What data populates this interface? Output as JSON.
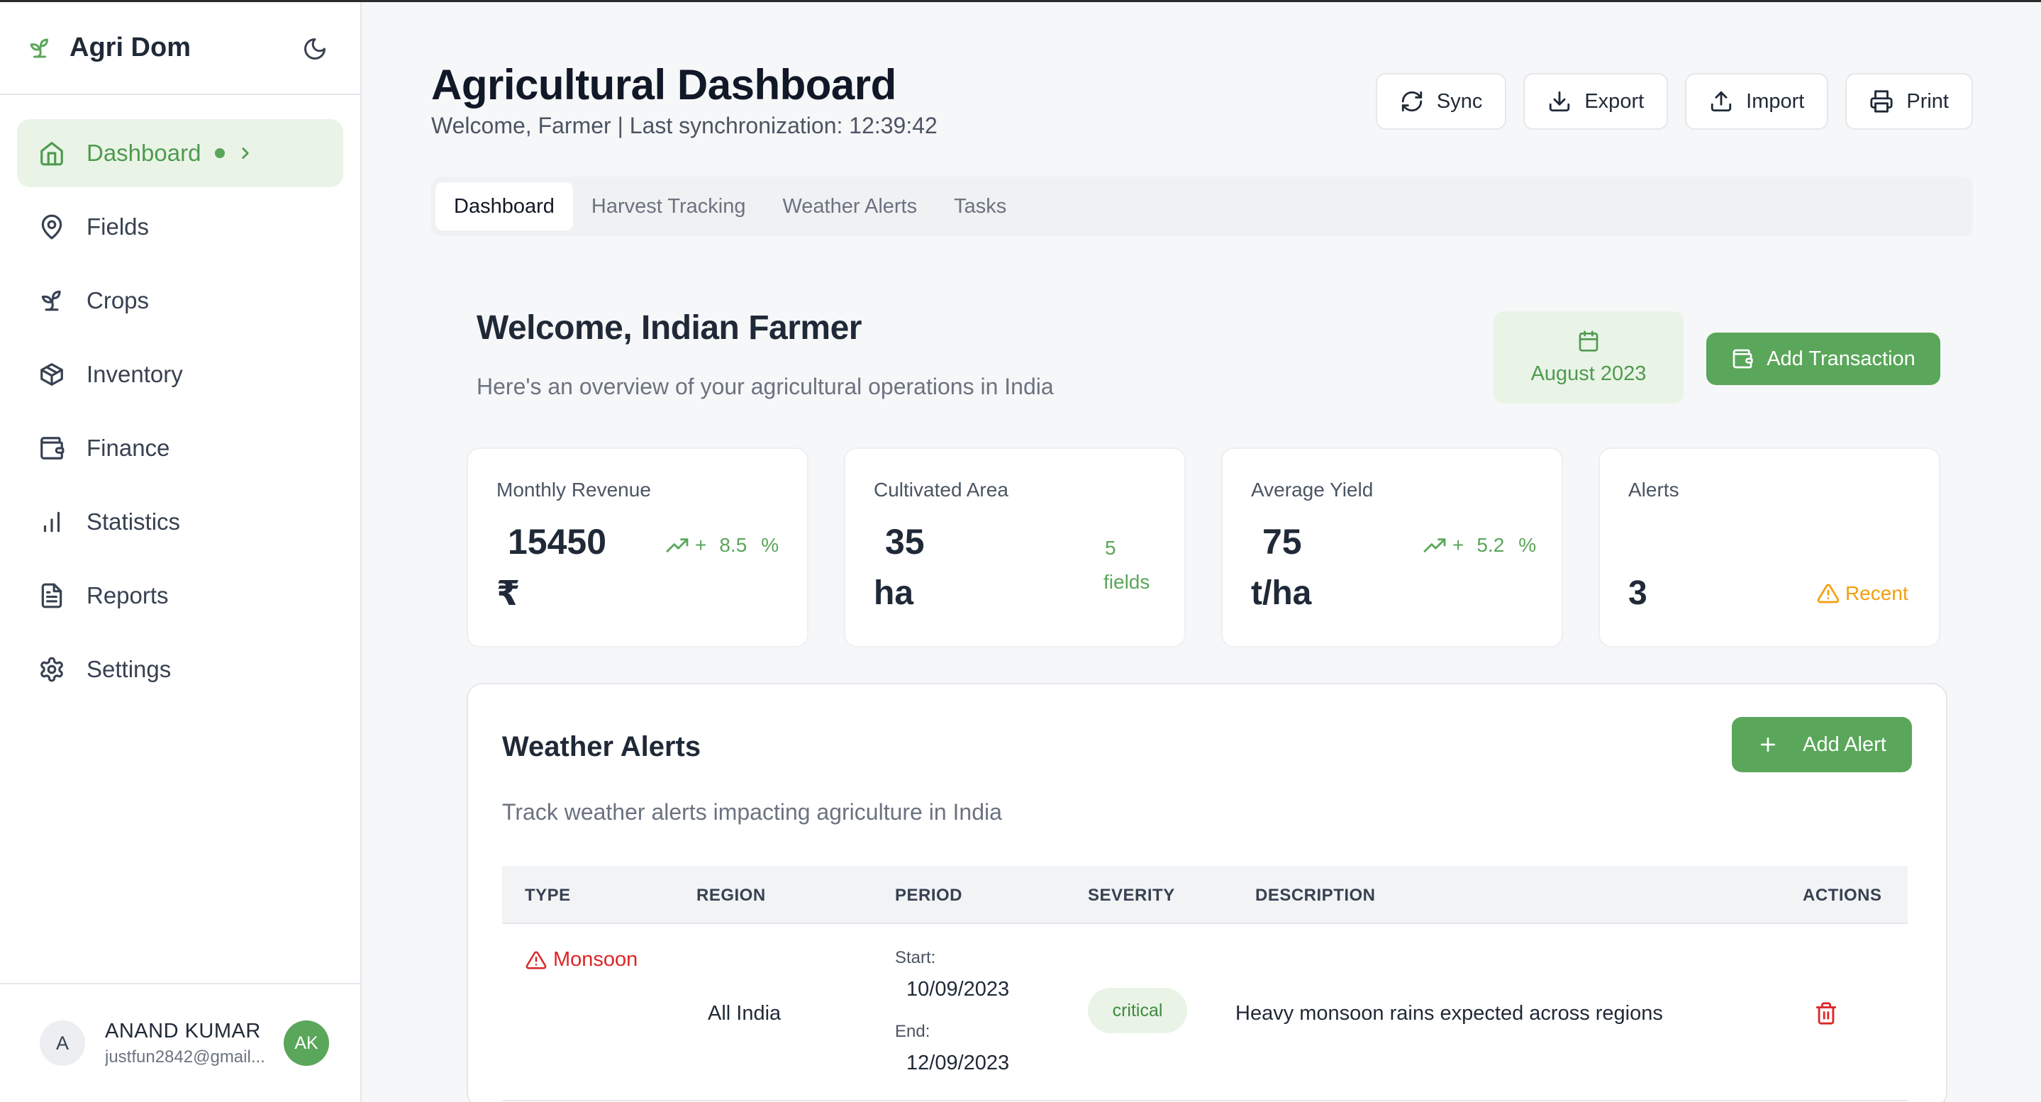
{
  "app": {
    "name": "Agri Dom"
  },
  "sidebar": {
    "items": [
      {
        "label": "Dashboard",
        "icon": "home-icon",
        "active": true
      },
      {
        "label": "Fields",
        "icon": "map-pin-icon"
      },
      {
        "label": "Crops",
        "icon": "sprout-icon"
      },
      {
        "label": "Inventory",
        "icon": "package-icon"
      },
      {
        "label": "Finance",
        "icon": "wallet-icon"
      },
      {
        "label": "Statistics",
        "icon": "bar-chart-icon"
      },
      {
        "label": "Reports",
        "icon": "file-text-icon"
      },
      {
        "label": "Settings",
        "icon": "gear-icon"
      }
    ]
  },
  "user": {
    "initial": "A",
    "name": "ANAND KUMAR",
    "email": "justfun2842@gmail...",
    "badge": "AK"
  },
  "header": {
    "title": "Agricultural Dashboard",
    "subtitle": "Welcome, Farmer | Last synchronization: 12:39:42",
    "actions": {
      "sync": "Sync",
      "export": "Export",
      "import": "Import",
      "print": "Print"
    }
  },
  "tabs": [
    {
      "label": "Dashboard",
      "active": true
    },
    {
      "label": "Harvest Tracking"
    },
    {
      "label": "Weather Alerts"
    },
    {
      "label": "Tasks"
    }
  ],
  "welcome": {
    "title": "Welcome, Indian Farmer",
    "subtitle": "Here's an overview of your agricultural operations in India",
    "date": "August 2023",
    "add_transaction": "Add Transaction"
  },
  "stats": {
    "revenue": {
      "label": "Monthly Revenue",
      "value": "15450",
      "unit": "₹",
      "trend_sign": "+",
      "trend_value": "8.5",
      "trend_unit": "%"
    },
    "area": {
      "label": "Cultivated Area",
      "value": "35",
      "unit": "ha",
      "fields_count": "5",
      "fields_label": "fields"
    },
    "yield": {
      "label": "Average Yield",
      "value": "75",
      "unit": "t/ha",
      "trend_sign": "+",
      "trend_value": "5.2",
      "trend_unit": "%"
    },
    "alerts": {
      "label": "Alerts",
      "value": "3",
      "status": "Recent"
    }
  },
  "weather": {
    "title": "Weather Alerts",
    "subtitle": "Track weather alerts impacting agriculture in India",
    "add_label": "Add Alert",
    "columns": [
      "TYPE",
      "REGION",
      "PERIOD",
      "SEVERITY",
      "DESCRIPTION",
      "ACTIONS"
    ],
    "rows": [
      {
        "type": "Monsoon",
        "region": "All India",
        "start_label": "Start:",
        "start": "10/09/2023",
        "end_label": "End:",
        "end": "12/09/2023",
        "severity": "critical",
        "description": "Heavy monsoon rains expected across regions"
      }
    ]
  },
  "colors": {
    "accent": "#5aa65a",
    "accent_light": "#e9f4e7",
    "danger": "#dc2626",
    "warning": "#f59e0b"
  }
}
